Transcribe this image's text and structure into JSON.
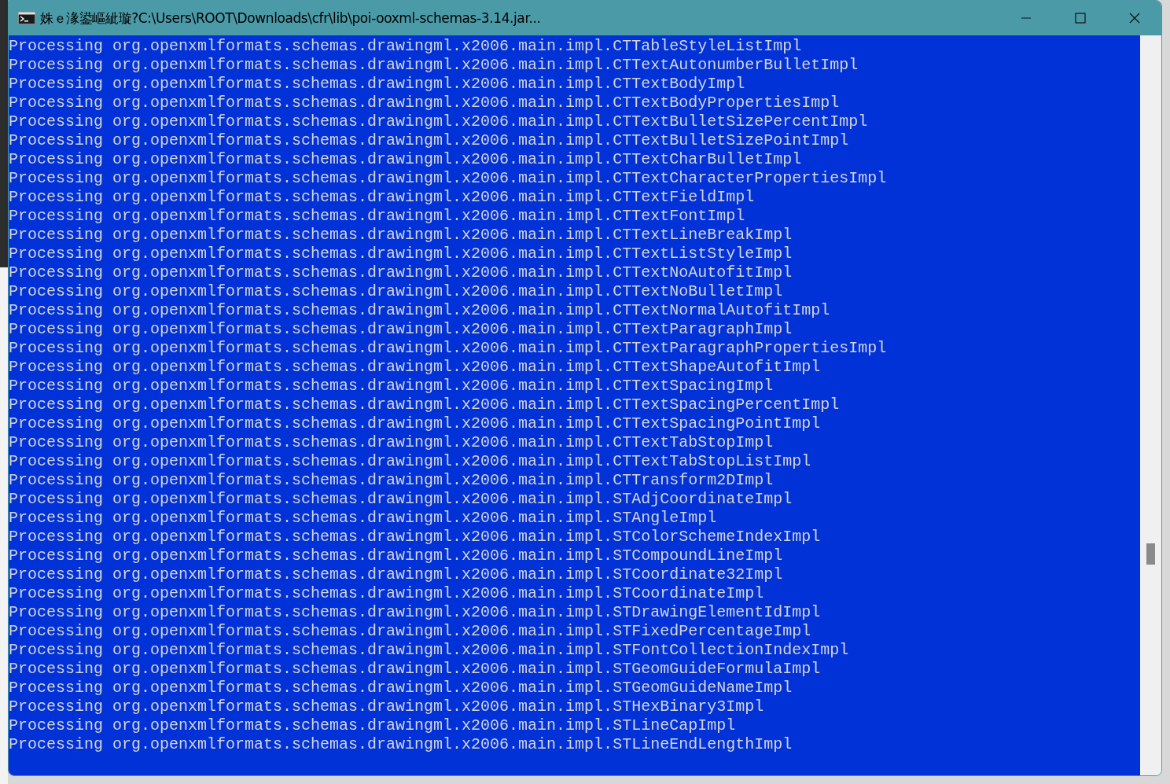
{
  "window": {
    "title": "姝ｅ湪鍙嶇紪璇?C:\\Users\\ROOT\\Downloads\\cfr\\lib\\poi-ooxml-schemas-3.14.jar..."
  },
  "console": {
    "lines": [
      "Processing org.openxmlformats.schemas.drawingml.x2006.main.impl.CTTableStyleListImpl",
      "Processing org.openxmlformats.schemas.drawingml.x2006.main.impl.CTTextAutonumberBulletImpl",
      "Processing org.openxmlformats.schemas.drawingml.x2006.main.impl.CTTextBodyImpl",
      "Processing org.openxmlformats.schemas.drawingml.x2006.main.impl.CTTextBodyPropertiesImpl",
      "Processing org.openxmlformats.schemas.drawingml.x2006.main.impl.CTTextBulletSizePercentImpl",
      "Processing org.openxmlformats.schemas.drawingml.x2006.main.impl.CTTextBulletSizePointImpl",
      "Processing org.openxmlformats.schemas.drawingml.x2006.main.impl.CTTextCharBulletImpl",
      "Processing org.openxmlformats.schemas.drawingml.x2006.main.impl.CTTextCharacterPropertiesImpl",
      "Processing org.openxmlformats.schemas.drawingml.x2006.main.impl.CTTextFieldImpl",
      "Processing org.openxmlformats.schemas.drawingml.x2006.main.impl.CTTextFontImpl",
      "Processing org.openxmlformats.schemas.drawingml.x2006.main.impl.CTTextLineBreakImpl",
      "Processing org.openxmlformats.schemas.drawingml.x2006.main.impl.CTTextListStyleImpl",
      "Processing org.openxmlformats.schemas.drawingml.x2006.main.impl.CTTextNoAutofitImpl",
      "Processing org.openxmlformats.schemas.drawingml.x2006.main.impl.CTTextNoBulletImpl",
      "Processing org.openxmlformats.schemas.drawingml.x2006.main.impl.CTTextNormalAutofitImpl",
      "Processing org.openxmlformats.schemas.drawingml.x2006.main.impl.CTTextParagraphImpl",
      "Processing org.openxmlformats.schemas.drawingml.x2006.main.impl.CTTextParagraphPropertiesImpl",
      "Processing org.openxmlformats.schemas.drawingml.x2006.main.impl.CTTextShapeAutofitImpl",
      "Processing org.openxmlformats.schemas.drawingml.x2006.main.impl.CTTextSpacingImpl",
      "Processing org.openxmlformats.schemas.drawingml.x2006.main.impl.CTTextSpacingPercentImpl",
      "Processing org.openxmlformats.schemas.drawingml.x2006.main.impl.CTTextSpacingPointImpl",
      "Processing org.openxmlformats.schemas.drawingml.x2006.main.impl.CTTextTabStopImpl",
      "Processing org.openxmlformats.schemas.drawingml.x2006.main.impl.CTTextTabStopListImpl",
      "Processing org.openxmlformats.schemas.drawingml.x2006.main.impl.CTTransform2DImpl",
      "Processing org.openxmlformats.schemas.drawingml.x2006.main.impl.STAdjCoordinateImpl",
      "Processing org.openxmlformats.schemas.drawingml.x2006.main.impl.STAngleImpl",
      "Processing org.openxmlformats.schemas.drawingml.x2006.main.impl.STColorSchemeIndexImpl",
      "Processing org.openxmlformats.schemas.drawingml.x2006.main.impl.STCompoundLineImpl",
      "Processing org.openxmlformats.schemas.drawingml.x2006.main.impl.STCoordinate32Impl",
      "Processing org.openxmlformats.schemas.drawingml.x2006.main.impl.STCoordinateImpl",
      "Processing org.openxmlformats.schemas.drawingml.x2006.main.impl.STDrawingElementIdImpl",
      "Processing org.openxmlformats.schemas.drawingml.x2006.main.impl.STFixedPercentageImpl",
      "Processing org.openxmlformats.schemas.drawingml.x2006.main.impl.STFontCollectionIndexImpl",
      "Processing org.openxmlformats.schemas.drawingml.x2006.main.impl.STGeomGuideFormulaImpl",
      "Processing org.openxmlformats.schemas.drawingml.x2006.main.impl.STGeomGuideNameImpl",
      "Processing org.openxmlformats.schemas.drawingml.x2006.main.impl.STHexBinary3Impl",
      "Processing org.openxmlformats.schemas.drawingml.x2006.main.impl.STLineCapImpl",
      "Processing org.openxmlformats.schemas.drawingml.x2006.main.impl.STLineEndLengthImpl"
    ]
  }
}
